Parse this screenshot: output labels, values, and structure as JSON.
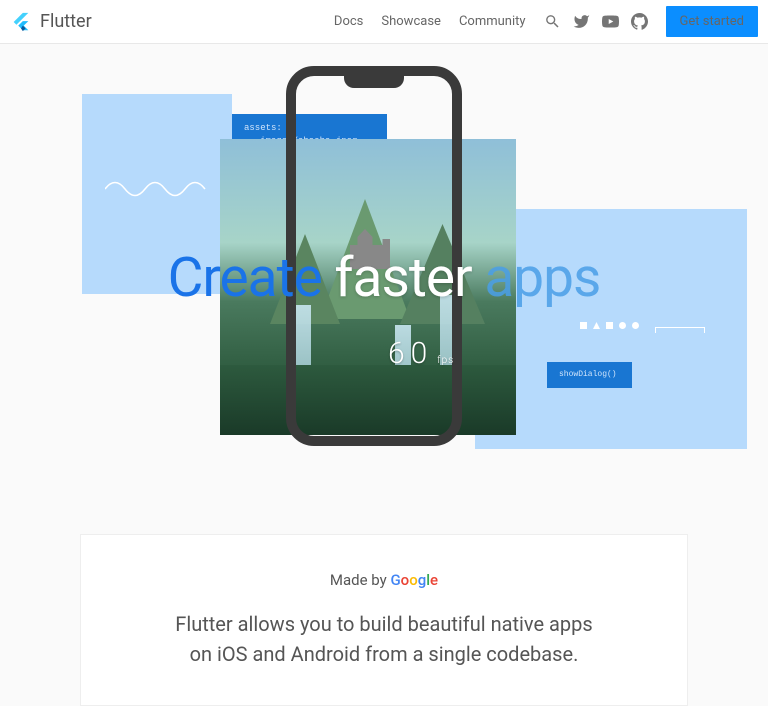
{
  "header": {
    "brand": "Flutter",
    "nav": [
      "Docs",
      "Showcase",
      "Community"
    ],
    "cta": "Get started"
  },
  "hero": {
    "headline": {
      "w1": "Create",
      "w2": "faster",
      "w3": "apps"
    },
    "fps_number": "60",
    "fps_label": "fps",
    "code_snippet_1": "assets:\n - images/abaaba.jpeg\n - images/fern.jpeg",
    "code_snippet_2": "showDialog()"
  },
  "card": {
    "madeby_prefix": "Made by ",
    "google_letters": {
      "G": "G",
      "o1": "o",
      "o2": "o",
      "g": "g",
      "l": "l",
      "e": "e"
    },
    "tagline": "Flutter allows you to build beautiful native apps on iOS and Android from a single codebase."
  },
  "colors": {
    "primary": "#0b8eff",
    "accent": "#1a73e8"
  }
}
